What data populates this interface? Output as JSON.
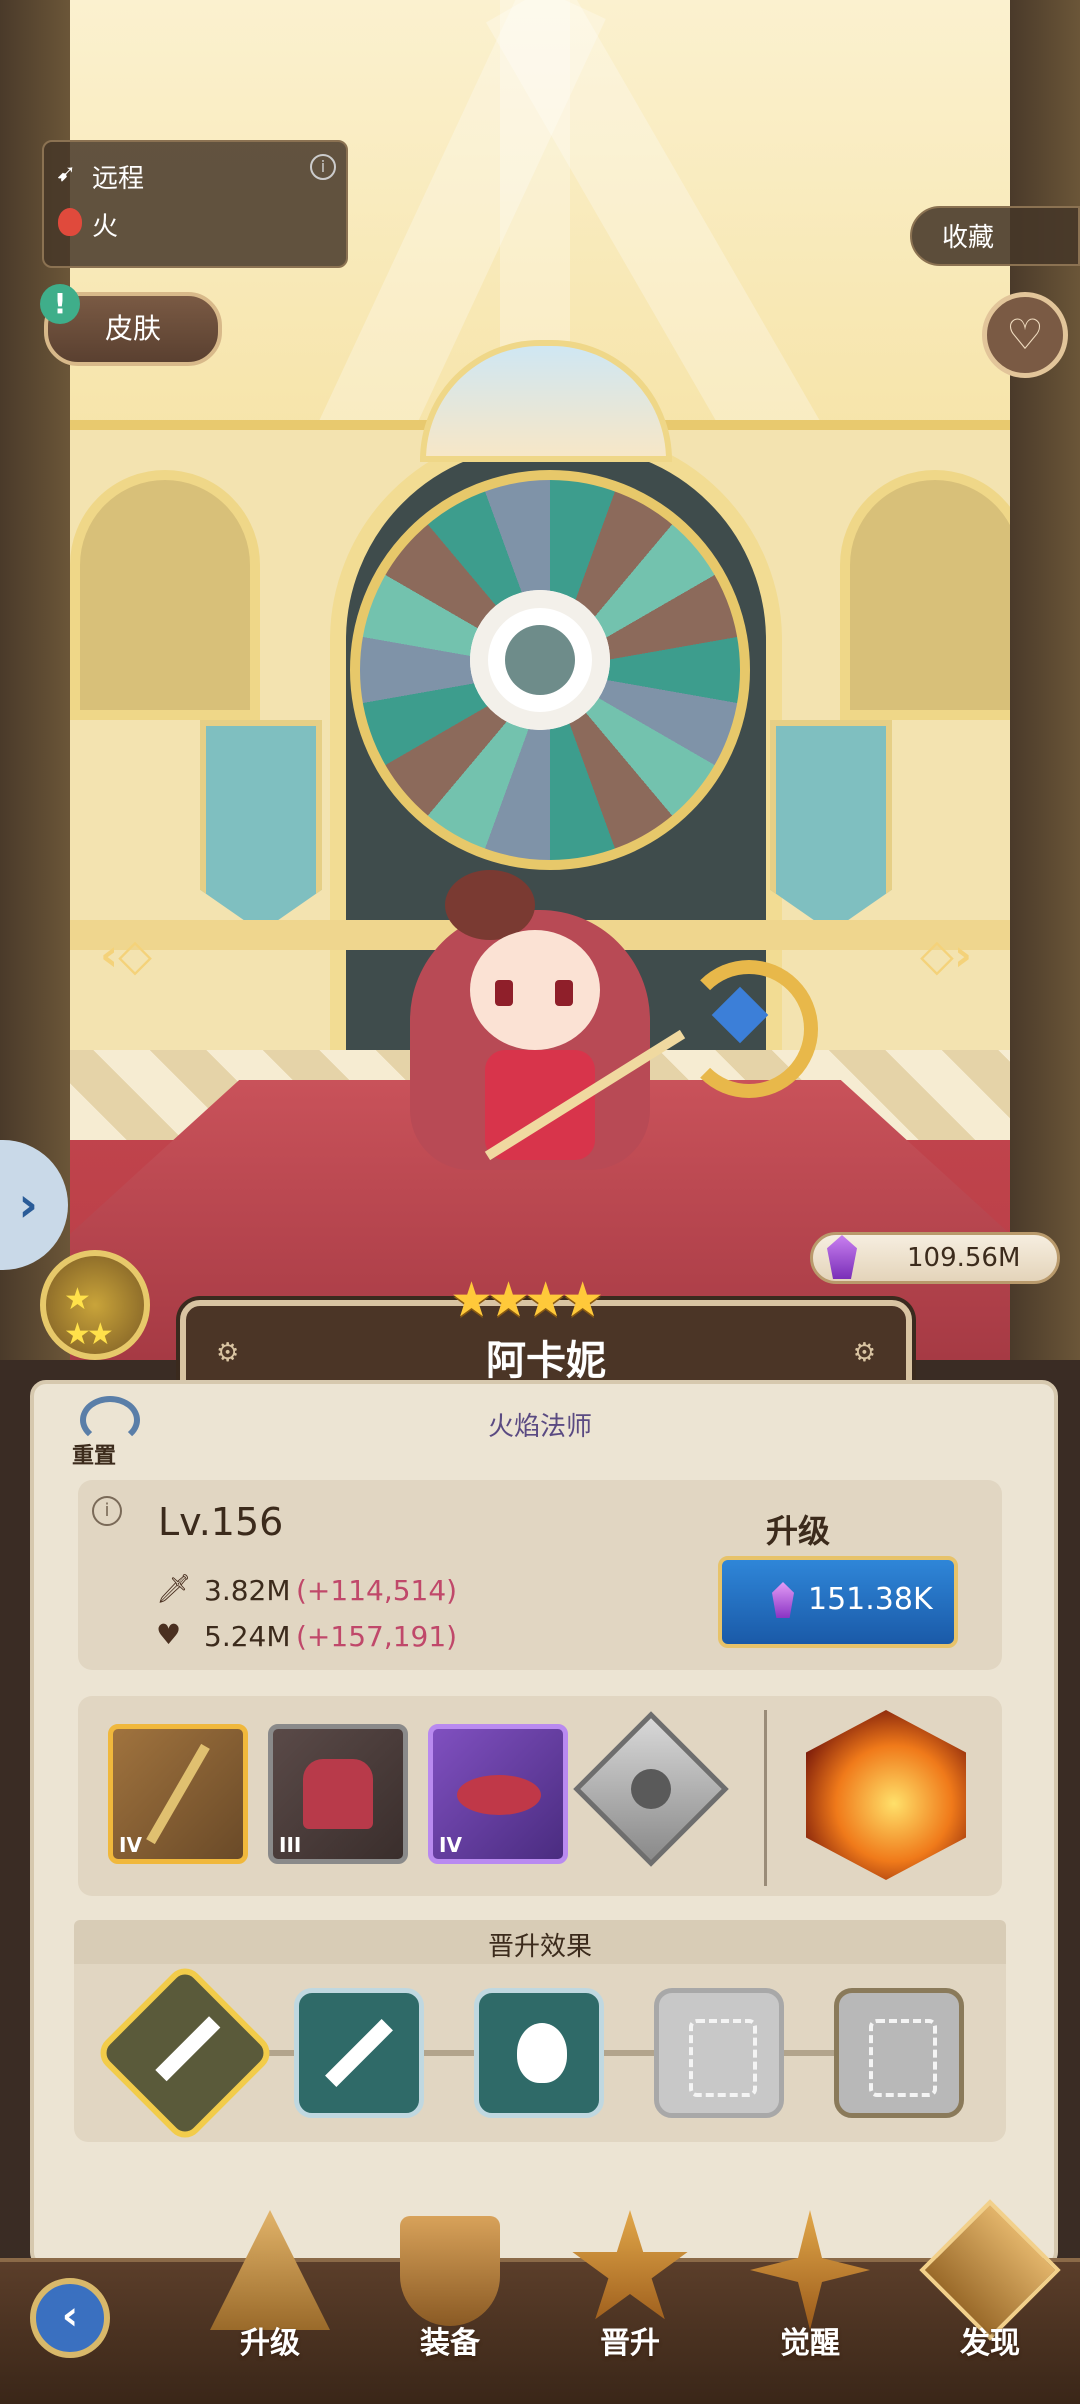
{
  "hero": {
    "attack_type": "远程",
    "element": "火",
    "name": "阿卡妮",
    "class": "火焰法师",
    "stars": 4,
    "level": "Lv.156",
    "attack": "3.82M",
    "attack_bonus": "(+114,514)",
    "hp": "5.24M",
    "hp_bonus": "(+157,191)"
  },
  "buttons": {
    "skin": "皮肤",
    "collect": "收藏",
    "reset": "重置",
    "upgrade_title": "升级",
    "upgrade_cost": "151.38K"
  },
  "currency": {
    "crystal": "109.56M"
  },
  "equipment": [
    {
      "icon": "staff-icon",
      "tier": "IV",
      "color": "#f0b83c"
    },
    {
      "icon": "robe-icon",
      "tier": "III",
      "color": "#8a8a8a"
    },
    {
      "icon": "hat-icon",
      "tier": "IV",
      "color": "#8f5cc9"
    },
    {
      "icon": "locked-rune-icon",
      "tier": "",
      "color": "#9a9a9a"
    }
  ],
  "skill": {
    "icon": "fireball-skill-icon"
  },
  "promotion": {
    "title": "晋升效果",
    "nodes": [
      {
        "icon": "sword-icon",
        "state": "active"
      },
      {
        "icon": "sword-icon",
        "state": "unlocked"
      },
      {
        "icon": "fire-icon",
        "state": "unlocked"
      },
      {
        "icon": "claw-icon",
        "state": "locked"
      },
      {
        "icon": "claw-icon",
        "state": "locked"
      }
    ]
  },
  "nav": [
    {
      "label": "升级",
      "icon": "upgrade-icon"
    },
    {
      "label": "装备",
      "icon": "equipment-icon"
    },
    {
      "label": "晋升",
      "icon": "promote-icon"
    },
    {
      "label": "觉醒",
      "icon": "awaken-icon"
    },
    {
      "label": "发现",
      "icon": "discover-icon"
    }
  ],
  "colors": {
    "accent_blue": "#1f6fc0",
    "bonus_pink": "#c0486a",
    "gold": "#f2b632"
  }
}
